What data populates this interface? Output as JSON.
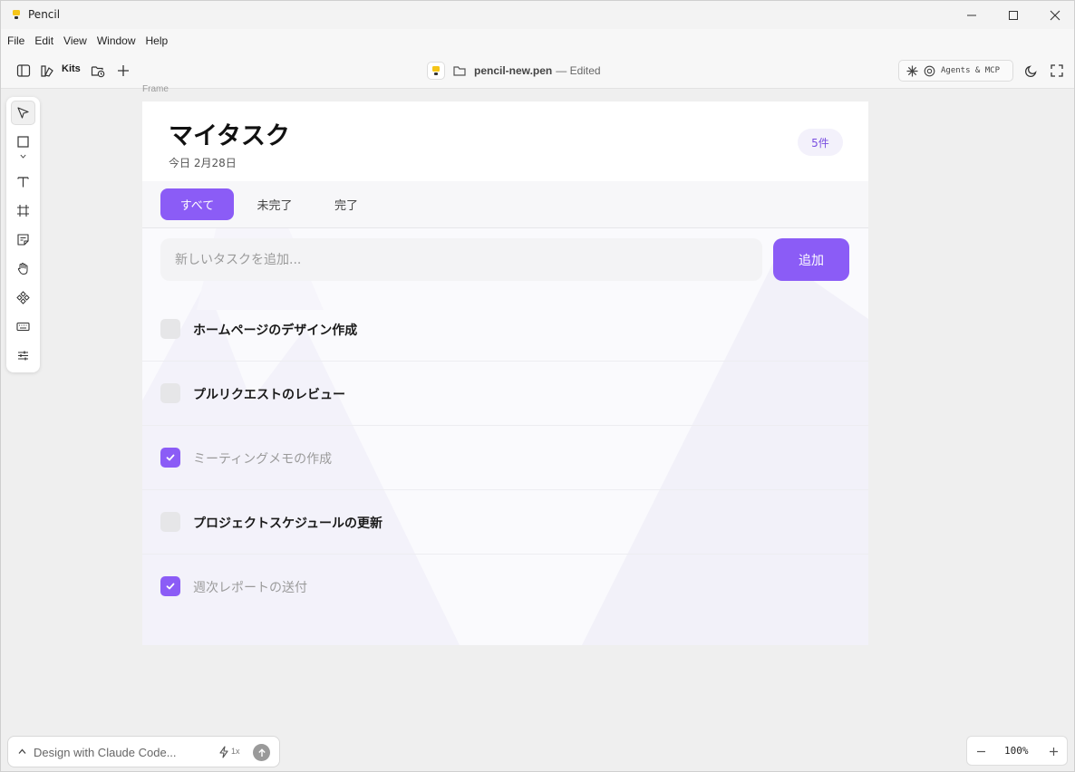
{
  "window": {
    "title": "Pencil"
  },
  "menu": [
    "File",
    "Edit",
    "View",
    "Window",
    "Help"
  ],
  "toolbar": {
    "kits_label": "Kits",
    "file_name": "pencil-new.pen",
    "file_status": "— Edited",
    "agents_label": "Agents & MCP"
  },
  "canvas": {
    "frame_label": "Frame"
  },
  "app": {
    "title": "マイタスク",
    "date": "今日 2月28日",
    "count": "5件",
    "accent": "#8b5cf6",
    "tabs": [
      {
        "label": "すべて",
        "active": true
      },
      {
        "label": "未完了",
        "active": false
      },
      {
        "label": "完了",
        "active": false
      }
    ],
    "input_placeholder": "新しいタスクを追加...",
    "add_label": "追加",
    "tasks": [
      {
        "text": "ホームページのデザイン作成",
        "done": false
      },
      {
        "text": "プルリクエストのレビュー",
        "done": false
      },
      {
        "text": "ミーティングメモの作成",
        "done": true
      },
      {
        "text": "プロジェクトスケジュールの更新",
        "done": false
      },
      {
        "text": "週次レポートの送付",
        "done": true
      }
    ]
  },
  "tools": [
    "cursor-icon",
    "rectangle-icon",
    "chevron-down-icon",
    "text-icon",
    "frame-icon",
    "sticky-note-icon",
    "hand-icon",
    "component-icon",
    "keyboard-icon",
    "sliders-icon"
  ],
  "bottom": {
    "prompt_placeholder": "Design with Claude Code...",
    "speed_label": "1x",
    "zoom": "100%"
  }
}
